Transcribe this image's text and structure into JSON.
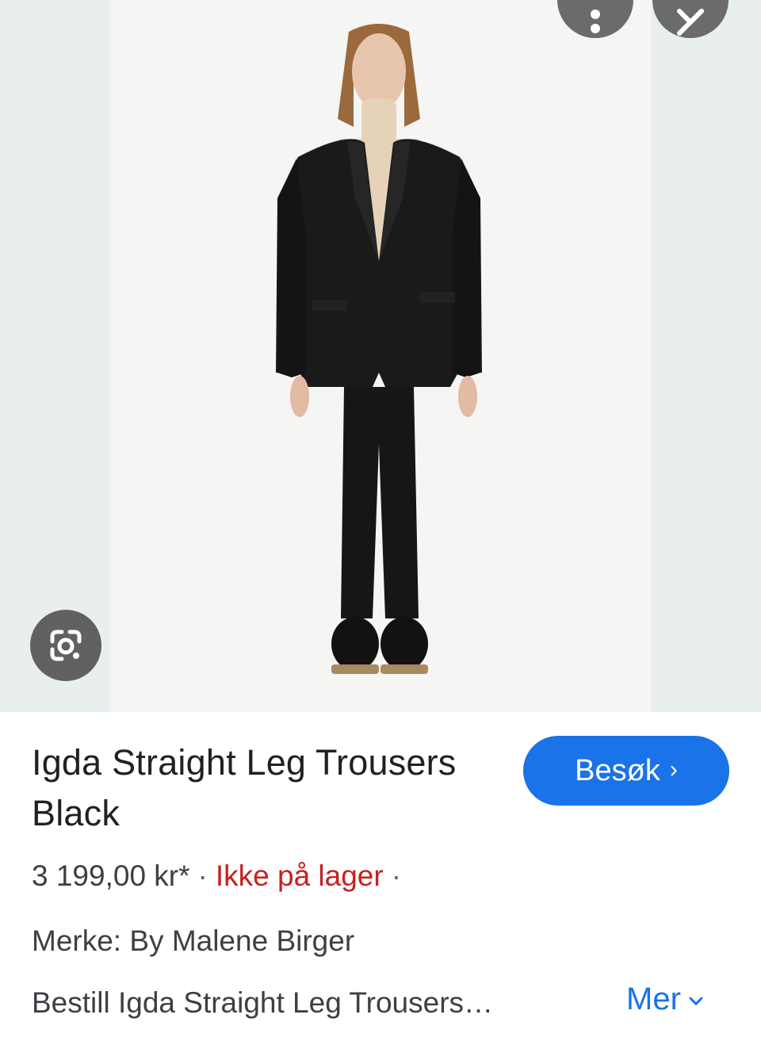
{
  "product": {
    "title": "Igda Straight Leg Trousers Black",
    "price": "3 199,00 kr*",
    "availability": "Ikke på lager",
    "brand_line": "Merke: By Malene Birger",
    "description": "Bestill Igda Straight Leg Trousers…"
  },
  "actions": {
    "visit_label": "Besøk",
    "more_label": "Mer"
  },
  "icons": {
    "more": "more-vert-icon",
    "close": "close-icon",
    "lens": "google-lens-icon",
    "visit_chevron": "chevron-right-icon",
    "more_chevron": "chevron-down-icon"
  },
  "colors": {
    "accent": "#1a73e8",
    "out_of_stock": "#c5221f",
    "overlay_button": "#616161",
    "side_background": "#e9eeef",
    "photo_background": "#f5f5f4"
  }
}
